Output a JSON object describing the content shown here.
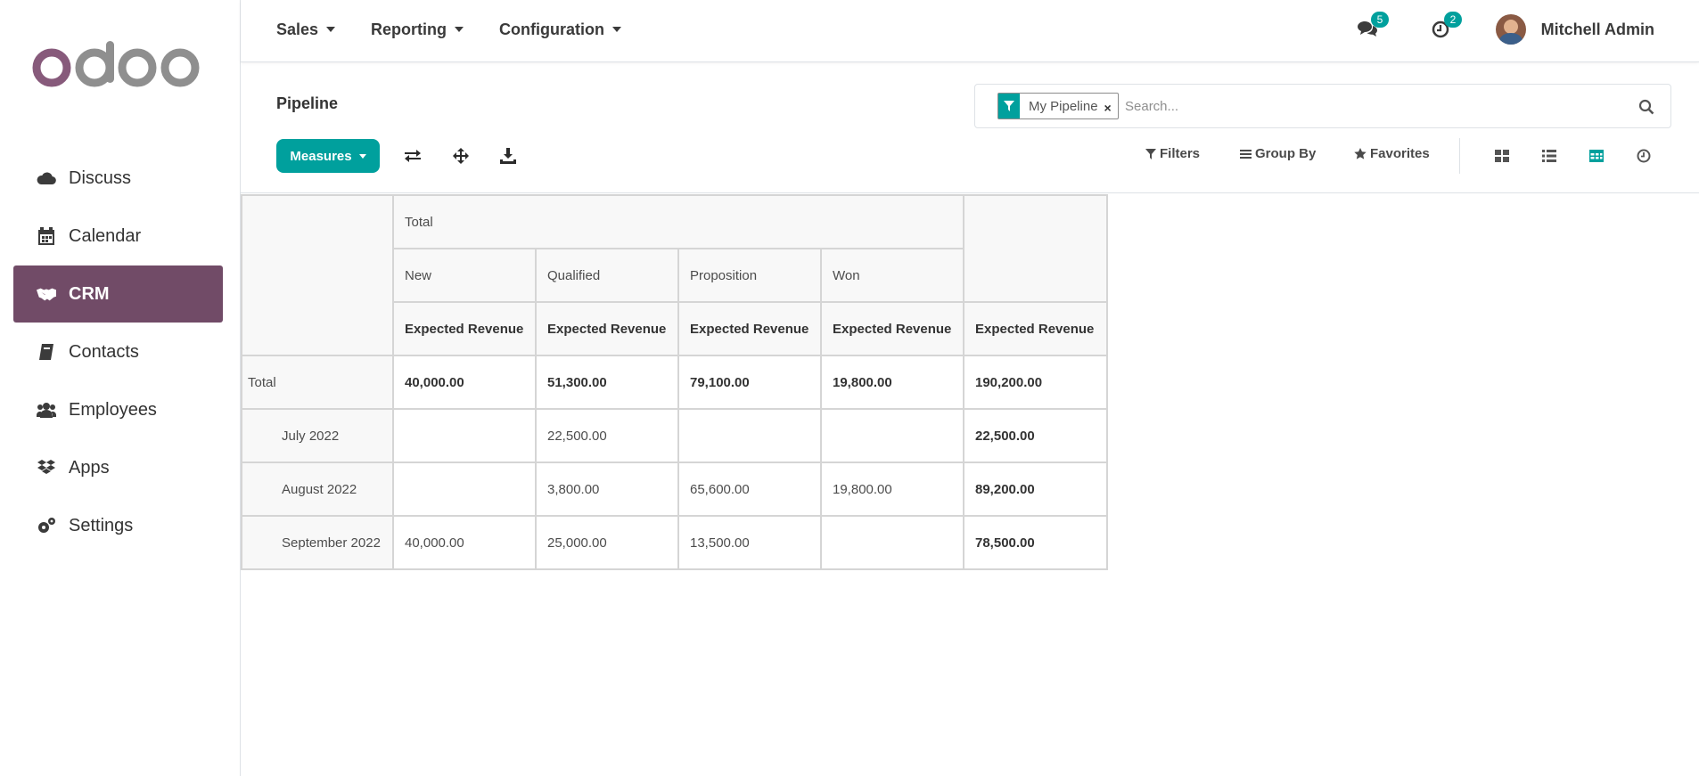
{
  "brand": {
    "logo_text": "odoo",
    "colors": {
      "o1": "#875a7b",
      "rest": "#8f8f8f"
    }
  },
  "sidebar": {
    "items": [
      {
        "label": "Discuss",
        "icon": "cloud-icon"
      },
      {
        "label": "Calendar",
        "icon": "calendar-icon"
      },
      {
        "label": "CRM",
        "icon": "handshake-icon",
        "active": true
      },
      {
        "label": "Contacts",
        "icon": "address-book-icon"
      },
      {
        "label": "Employees",
        "icon": "users-icon"
      },
      {
        "label": "Apps",
        "icon": "dropbox-icon"
      },
      {
        "label": "Settings",
        "icon": "cogs-icon"
      }
    ],
    "active_color": "#714b67"
  },
  "topbar": {
    "menus": [
      "Sales",
      "Reporting",
      "Configuration"
    ],
    "messages_count": "5",
    "activities_count": "2",
    "user_name": "Mitchell Admin"
  },
  "control_panel": {
    "breadcrumb": "Pipeline",
    "search": {
      "facet_label": "My Pipeline",
      "facet_remove": "×",
      "placeholder": "Search..."
    },
    "measures_label": "Measures",
    "filters_label": "Filters",
    "group_by_label": "Group By",
    "favorites_label": "Favorites",
    "active_view": "pivot",
    "accent": "#00a09d"
  },
  "pivot": {
    "col_group": "Total",
    "columns": [
      "New",
      "Qualified",
      "Proposition",
      "Won"
    ],
    "measure": "Expected Revenue",
    "rows": [
      {
        "label": "Total",
        "values": [
          "40,000.00",
          "51,300.00",
          "79,100.00",
          "19,800.00"
        ],
        "total": "190,200.00"
      },
      {
        "label": "July 2022",
        "values": [
          "",
          "22,500.00",
          "",
          ""
        ],
        "total": "22,500.00"
      },
      {
        "label": "August 2022",
        "values": [
          "",
          "3,800.00",
          "65,600.00",
          "19,800.00"
        ],
        "total": "89,200.00"
      },
      {
        "label": "September 2022",
        "values": [
          "40,000.00",
          "25,000.00",
          "13,500.00",
          ""
        ],
        "total": "78,500.00"
      }
    ]
  }
}
